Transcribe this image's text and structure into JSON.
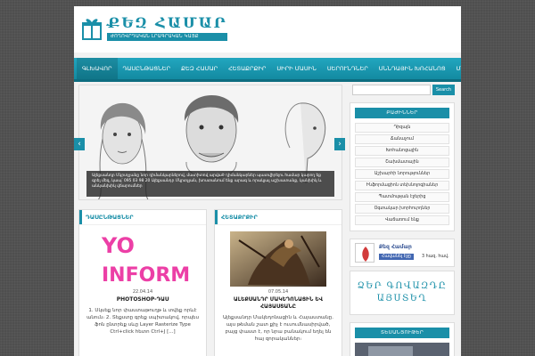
{
  "logo": {
    "title": "ՔԵԶ ՀԱՄԱՐ",
    "subtitle": "ԺՈՂՈՎՐԴԱԿԱՆ ԼՐԱԳՐԱԿԱՆ ԿԱՅՔ"
  },
  "nav": {
    "items": [
      "ԳԼԽԱՎՈՐ",
      "ԴԱՍԸՆԹԱՑՆԵՐ",
      "ՔԵԶ ՀԱՄԱՐ",
      "ՀԵՏԱՔՐՔԻՐ",
      "ՍԻՐԻ ՄԱՍԻՆ",
      "ՍԵՐՈՒՆԴՆԵՐ",
      "ՍՆՆԴԱՅԻՆ ԽՈՀԱՆՈՑ",
      "ՄԵՐ ՄԱՍԻՆ"
    ]
  },
  "slider": {
    "caption": "Ալեքսանդր Մկրտչյանը նոր դիմանկարներով, մատիտով արված դիմանկարներ պատվիրելու համար կարող եք գրել մեզ, կապ՝ 095 03 98 20 Ալեքսանդր Մկրտչյան, խոստանում ենք արագ և որակյալ աշխատանք, կանխիկ և անկանխիկ վճարումներ"
  },
  "columns": [
    {
      "heading": "ԴԱՍԸՆԹԱՑՆԵՐ",
      "thumb_text_1": "YO",
      "thumb_text_2": "INFORM",
      "date": "22.04.14",
      "title": "PHOTOSHOP-ԴԱՍ",
      "excerpt": "1. Սկսեք նոր փաստաթուղթ և տվեք որևէ անուն։ 2. Տեքստը գրեք սպիտակով, որպես ֆոն ընտրեք սևը Layer Rasterize Type Ctrl+click հետո Ctrl+J [...]"
    },
    {
      "heading": "ՀԵՏԱՔՐՔԻՐ",
      "date": "07.05.14",
      "title": "ԱԼԵՔՍԱՆԴՐ ՄԱԿԵԴՈՆԱՑԻՆ ԵՎ ՀԱՅԱՍՏԱՆԸ",
      "excerpt": "Ալեքսանդր Մակեդոնացին և Հայաստանը. այս թեման շատ քիչ է ուսումնասիրված, բայց փաստ է, որ նրա բանակում եղել են հայ զորականներ։"
    }
  ],
  "sidebar": {
    "search_label": "Search",
    "categories_heading": "ԲԱԺԻՆՆԵՐ",
    "categories": [
      "Դիզայն",
      "Ճանաչում",
      "Խոհանոցային",
      "Շախմատային",
      "Աշխարհի նորություններ",
      "Ինֆորմացիոն տեխնոլոգիաներ",
      "Պատմության էջերից",
      "Օգտակար խորհուրդներ",
      "Վաճառում ենք"
    ],
    "fb_name": "Քեզ Համար",
    "fb_like": "Հավանել էջը",
    "fb_count": "3 հազ. հավ.",
    "ad_line1": "ՁԵՐ ԳՈՎԱԶԴԸ",
    "ad_line2": "ԱՅՍՏԵՂ",
    "videos_heading": "ՏԵՍԱՆՅՈՒԹԵՐ"
  },
  "colors": {
    "accent": "#1a8fa8",
    "background": "#4f4f4f"
  }
}
